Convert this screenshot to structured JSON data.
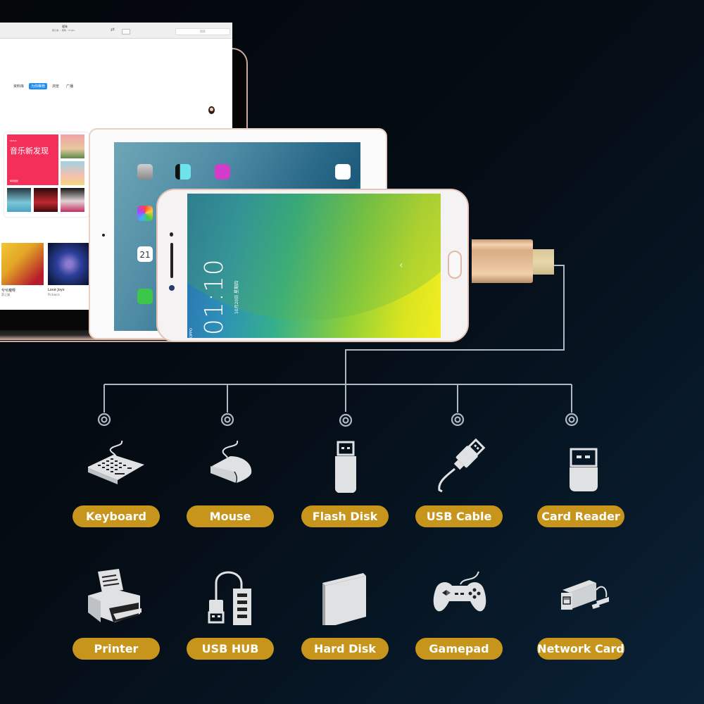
{
  "colors": {
    "background": "#050c14",
    "pill": "#c8951c",
    "pill_text": "#ffffff",
    "icon": "#dfe1e3",
    "connector_line": "#aeb8c2",
    "adapter_gold": "#e3bb93"
  },
  "laptop": {
    "window_title": "暧昧",
    "window_subtitle": "薛之谦 — 暧昧 - Single",
    "search_placeholder": "搜索",
    "nav_tabs": [
      {
        "label": "资料库",
        "active": false
      },
      {
        "label": "为你推荐",
        "active": true
      },
      {
        "label": "浏览",
        "active": false
      },
      {
        "label": "广播",
        "active": false
      }
    ],
    "featured": {
      "tag": "MUSIC",
      "title": "音乐新发现",
      "link": "每周更新"
    },
    "albums": [
      {
        "name": "兮兮瘦呀",
        "artist": "薛之谦"
      },
      {
        "name": "Love Joys",
        "artist": "Pickwick"
      }
    ]
  },
  "phone": {
    "time": "01:10",
    "date": "10月20日 星期四",
    "brand": "OPPO"
  },
  "devices": [
    {
      "label": "Keyboard",
      "icon": "keyboard-icon"
    },
    {
      "label": "Mouse",
      "icon": "mouse-icon"
    },
    {
      "label": "Flash Disk",
      "icon": "flash-disk-icon"
    },
    {
      "label": "USB Cable",
      "icon": "usb-cable-icon"
    },
    {
      "label": "Card Reader",
      "icon": "card-reader-icon"
    },
    {
      "label": "Printer",
      "icon": "printer-icon"
    },
    {
      "label": "USB HUB",
      "icon": "usb-hub-icon"
    },
    {
      "label": "Hard Disk",
      "icon": "hard-disk-icon"
    },
    {
      "label": "Gamepad",
      "icon": "gamepad-icon"
    },
    {
      "label": "Network Card",
      "icon": "network-card-icon"
    }
  ]
}
